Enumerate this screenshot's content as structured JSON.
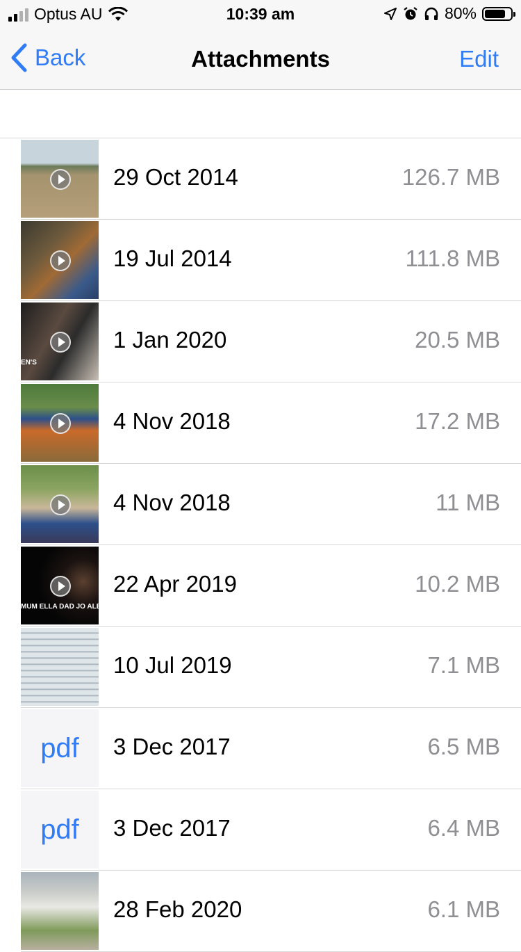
{
  "status_bar": {
    "carrier": "Optus AU",
    "time": "10:39 am",
    "battery": "80%",
    "battery_level": 0.8,
    "icons": [
      "signal-icon",
      "wifi-icon",
      "location-icon",
      "alarm-icon",
      "headphones-icon",
      "battery-icon"
    ]
  },
  "nav": {
    "back_label": "Back",
    "title": "Attachments",
    "edit_label": "Edit"
  },
  "attachments": [
    {
      "date": "29 Oct 2014",
      "size": "126.7 MB",
      "kind": "video"
    },
    {
      "date": "19 Jul 2014",
      "size": "111.8 MB",
      "kind": "video"
    },
    {
      "date": "1 Jan 2020",
      "size": "20.5 MB",
      "kind": "video",
      "overlay": "EN'S"
    },
    {
      "date": "4 Nov 2018",
      "size": "17.2 MB",
      "kind": "video"
    },
    {
      "date": "4 Nov 2018",
      "size": "11 MB",
      "kind": "video"
    },
    {
      "date": "22 Apr 2019",
      "size": "10.2 MB",
      "kind": "video",
      "overlay": "MUM ELLA DAD JO ALEX"
    },
    {
      "date": "10 Jul 2019",
      "size": "7.1 MB",
      "kind": "image"
    },
    {
      "date": "3 Dec 2017",
      "size": "6.5 MB",
      "kind": "pdf",
      "label": "pdf"
    },
    {
      "date": "3 Dec 2017",
      "size": "6.4 MB",
      "kind": "pdf",
      "label": "pdf"
    },
    {
      "date": "28 Feb 2020",
      "size": "6.1 MB",
      "kind": "image"
    }
  ],
  "colors": {
    "accent": "#2f7cf6",
    "secondary_text": "#8e8e93"
  }
}
